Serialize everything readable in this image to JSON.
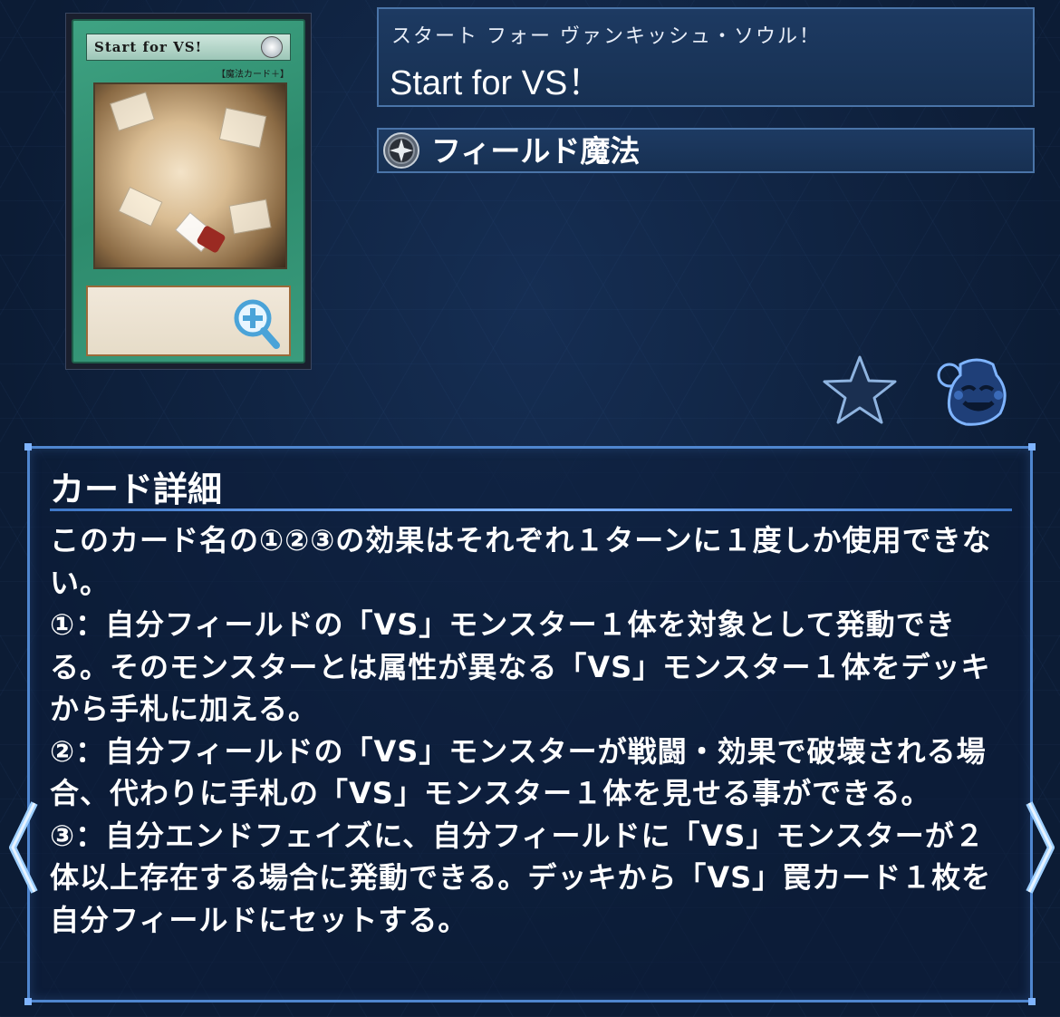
{
  "card_image": {
    "name": "Start for VS!",
    "ruby": "スタート・フォー・ヴァンキッシュ・ソウル",
    "type_line": "【魔法カード＋】"
  },
  "name_panel": {
    "ruby": "スタート フォー ヴァンキッシュ・ソウル！",
    "name": "Start for VS！"
  },
  "type_panel": {
    "label": "フィールド魔法"
  },
  "icons": {
    "zoom": "zoom-in-icon",
    "type": "field-spell-icon",
    "favorite": "star-icon",
    "pot": "pot-of-greed-icon",
    "nav_prev": "chevron-left-icon",
    "nav_next": "chevron-right-icon"
  },
  "detail": {
    "title": "カード詳細",
    "text": "このカード名の①②③の効果はそれぞれ１ターンに１度しか使用できない。\n①：自分フィールドの「VS」モンスター１体を対象として発動できる。そのモンスターとは属性が異なる「VS」モンスター１体をデッキから手札に加える。\n②：自分フィールドの「VS」モンスターが戦闘・効果で破壊される場合、代わりに手札の「VS」モンスター１体を見せる事ができる。\n③：自分エンドフェイズに、自分フィールドに「VS」モンスターが２体以上存在する場合に発動できる。デッキから「VS」罠カード１枚を自分フィールドにセットする。"
  },
  "colors": {
    "background": "#0c1c35",
    "panel": "#1d3a62",
    "border": "#4f86cf",
    "card_green": "#3fa383"
  }
}
